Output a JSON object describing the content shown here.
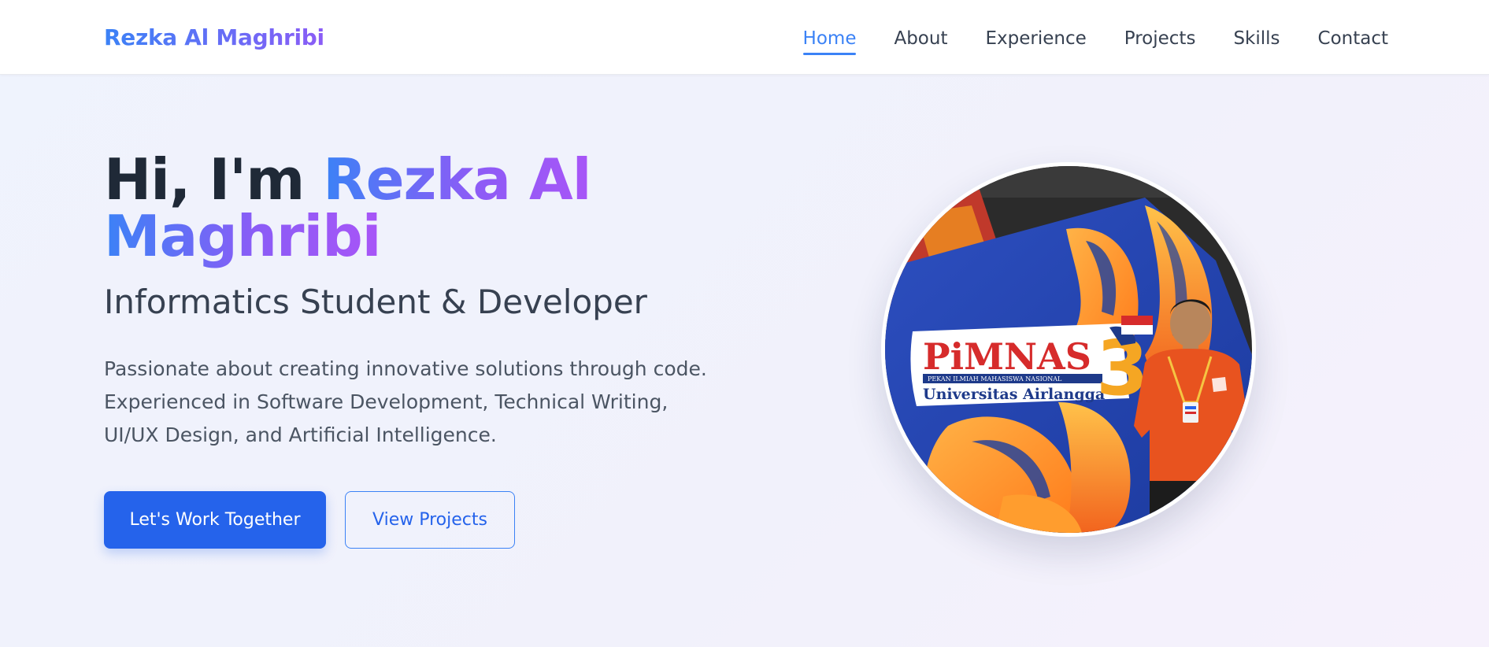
{
  "nav": {
    "brand": "Rezka Al Maghribi",
    "links": [
      {
        "label": "Home",
        "active": true
      },
      {
        "label": "About",
        "active": false
      },
      {
        "label": "Experience",
        "active": false
      },
      {
        "label": "Projects",
        "active": false
      },
      {
        "label": "Skills",
        "active": false
      },
      {
        "label": "Contact",
        "active": false
      }
    ]
  },
  "hero": {
    "greeting": "Hi, I'm ",
    "name_line1": "Rezka Al",
    "name_line2": "Maghribi",
    "subtitle": "Informatics Student & Developer",
    "description": "Passionate about creating innovative solutions through code. Experienced in Software Development, Technical Writing, UI/UX Design, and Artificial Intelligence.",
    "primary_button": "Let's Work Together",
    "secondary_button": "View Projects"
  },
  "photo": {
    "banner_title": "PiMNAS",
    "banner_tagline": "PEKAN ILMIAH MAHASISWA NASIONAL",
    "banner_university": "Universitas Airlangga",
    "banner_number": "3"
  },
  "colors": {
    "accent": "#3b82f6",
    "accent_dark": "#2563eb",
    "gradient_end": "#8b5cf6"
  }
}
